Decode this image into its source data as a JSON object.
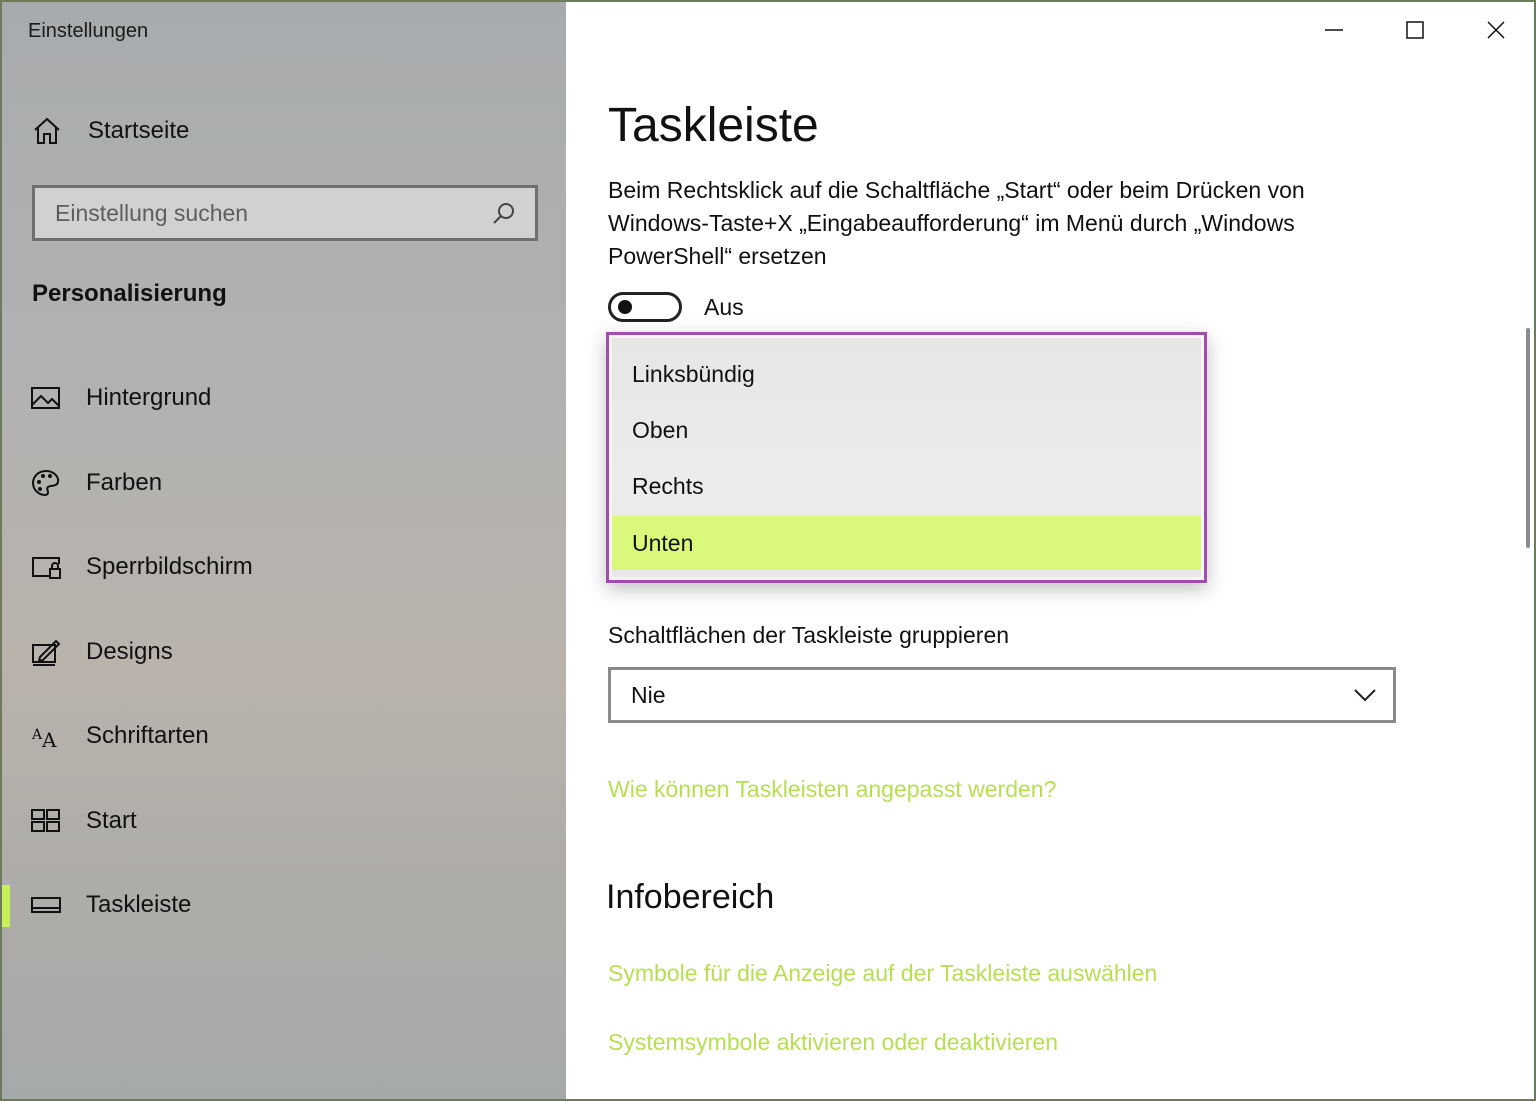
{
  "window": {
    "title": "Einstellungen"
  },
  "sidebar": {
    "home_label": "Startseite",
    "search": {
      "placeholder": "Einstellung suchen"
    },
    "section_title": "Personalisierung",
    "items": [
      {
        "label": "Hintergrund",
        "icon": "picture-icon"
      },
      {
        "label": "Farben",
        "icon": "palette-icon"
      },
      {
        "label": "Sperrbildschirm",
        "icon": "lock-screen-icon"
      },
      {
        "label": "Designs",
        "icon": "designs-icon"
      },
      {
        "label": "Schriftarten",
        "icon": "fonts-icon"
      },
      {
        "label": "Start",
        "icon": "start-tiles-icon"
      },
      {
        "label": "Taskleiste",
        "icon": "taskbar-icon",
        "active": true
      }
    ]
  },
  "main": {
    "title": "Taskleiste",
    "powershell_description": "Beim Rechtsklick auf die Schaltfläche „Start“ oder beim Drücken von Windows-Taste+X „Eingabeaufforderung“ im Menü durch „Windows PowerShell“ ersetzen",
    "powershell_toggle": {
      "state": "off",
      "label": "Aus"
    },
    "position_dropdown": {
      "options": [
        "Linksbündig",
        "Oben",
        "Rechts",
        "Unten"
      ],
      "selected": "Unten"
    },
    "group_buttons": {
      "label": "Schaltflächen der Taskleiste gruppieren",
      "value": "Nie"
    },
    "help_link": "Wie können Taskleisten angepasst werden?",
    "notification_area": {
      "heading": "Infobereich",
      "links": [
        "Symbole für die Anzeige auf der Taskleiste auswählen",
        "Systemsymbole aktivieren oder deaktivieren"
      ]
    }
  },
  "colors": {
    "accent": "#c7f05a",
    "link": "#b6df52",
    "selected_option": "#daf97a",
    "highlight_border": "#a24bb0"
  }
}
